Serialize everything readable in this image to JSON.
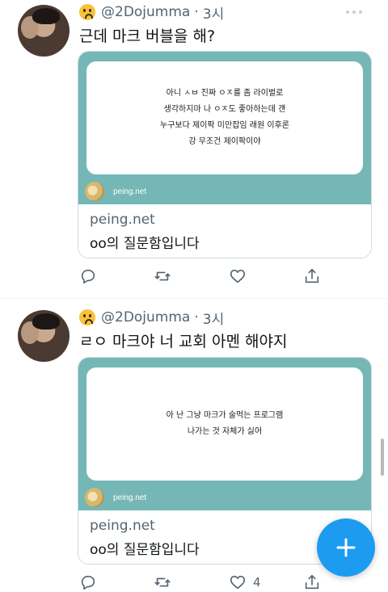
{
  "tweets": [
    {
      "handle": "@2Dojumma",
      "sep": "·",
      "time": "3시",
      "text": "근데 마크 버블을 해?",
      "card": {
        "lines": [
          "아니 ㅅㅂ 진짜 ㅇㅈ를 좀 라이벌로",
          "생각하지마 나 ㅇㅈ도 좋아하는데 걘",
          "누구보다 제이팍 미만잡임 래원 이후론",
          "강 무조건 제이팍이야"
        ],
        "site_label": "peing.net",
        "domain": "peing.net",
        "title": "oo의 질문함입니다"
      },
      "like_count": ""
    },
    {
      "handle": "@2Dojumma",
      "sep": "·",
      "time": "3시",
      "text": "ㄹㅇ 마크야 너 교회 아멘 해야지",
      "card": {
        "lines": [
          "아 난 그냥 마크가 술먹는 프로그램",
          "나가는 것 자체가 싫어"
        ],
        "site_label": "peing.net",
        "domain": "peing.net",
        "title": "oo의 질문함입니다"
      },
      "like_count": "4"
    }
  ],
  "icons": {
    "reply": "reply-icon",
    "retweet": "retweet-icon",
    "like": "heart-icon",
    "share": "share-icon",
    "compose": "plus-icon",
    "emoji": "worried-face-emoji",
    "more": "more-options-icon"
  },
  "colors": {
    "card_teal": "#74b7b6",
    "fab_blue": "#1d9bf0",
    "secondary_text": "#536471"
  }
}
